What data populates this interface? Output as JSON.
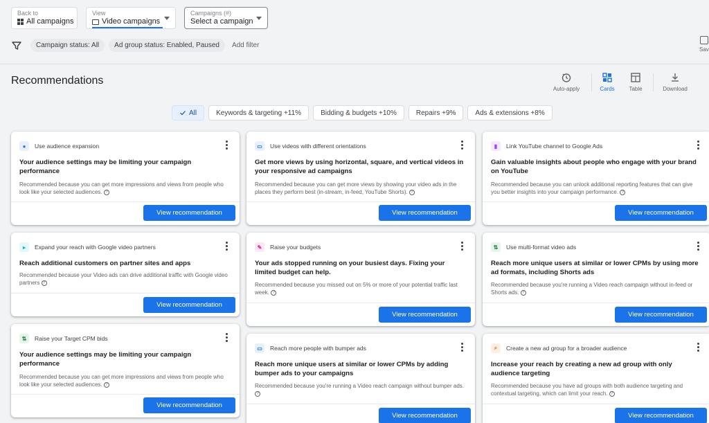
{
  "header": {
    "back": {
      "small": "Back to",
      "label": "All campaigns"
    },
    "view": {
      "small": "View",
      "label": "Video campaigns"
    },
    "campaigns": {
      "small": "Campaigns (#)",
      "label": "Select a campaign"
    }
  },
  "filters": {
    "chips": [
      "Campaign status: All",
      "Ad group status: Enabled, Paused"
    ],
    "add_label": "Add filter",
    "save_label": "Save"
  },
  "page": {
    "title": "Recommendations"
  },
  "tools": {
    "auto_apply": "Auto-apply",
    "cards": "Cards",
    "table": "Table",
    "download": "Download"
  },
  "categories": [
    "All",
    "Keywords & targeting +11%",
    "Bidding & budgets +10%",
    "Repairs +9%",
    "Ads & extensions +8%"
  ],
  "cards": [
    {
      "label": "Use audience expansion",
      "title": "Your audience settings may be limiting your campaign performance",
      "reason": "Recommended because you can get more impressions and views from people who look like your selected audiences.",
      "button": "View recommendation",
      "icon": "audience-icon",
      "icon_color": "#1a73e8",
      "icon_bg": "#e8f0fe"
    },
    {
      "label": "Use videos with different orientations",
      "title": "Get more views by using horizontal, square, and vertical videos in your responsive ad campaigns",
      "reason": "Recommended because you can get more views by showing your video ads in the places they perform best (in-stream, in-feed, YouTube Shorts).",
      "button": "View recommendation",
      "icon": "video-orientation-icon",
      "icon_color": "#1a73e8",
      "icon_bg": "#e8f0fe"
    },
    {
      "label": "Link YouTube channel to Google Ads",
      "title": "Gain valuable insights about people who engage with your brand on YouTube",
      "reason": "Recommended because you can unlock additional reporting features that can give you better insights into your campaign performance.",
      "button": "View recommendation",
      "icon": "insights-icon",
      "icon_color": "#a142f4",
      "icon_bg": "#f3e8fd"
    },
    {
      "label": "Expand your reach with Google video partners",
      "title": "Reach additional customers on partner sites and apps",
      "reason": "Recommended because your Video ads can drive additional traffic with Google video partners",
      "button": "View recommendation",
      "icon": "video-partners-icon",
      "icon_color": "#12b5cb",
      "icon_bg": "#e4f7fb"
    },
    {
      "label": "Raise your budgets",
      "title": "Your ads stopped running on your busiest days. Fixing your limited budget can help.",
      "reason": "Recommended because you missed out on 5% or more of your potential traffic last week.",
      "button": "View recommendation",
      "icon": "wrench-icon",
      "icon_color": "#e52592",
      "icon_bg": "#fde7f3"
    },
    {
      "label": "Use multi-format video ads",
      "title": "Reach more unique users at similar or lower CPMs by using more ad formats, including Shorts ads",
      "reason": "Recommended because you're running a Video reach campaign without in-feed or Shorts ads.",
      "button": "View recommendation",
      "icon": "arrows-icon",
      "icon_color": "#188038",
      "icon_bg": "#e6f4ea"
    },
    {
      "label": "Raise your Target CPM bids",
      "title": "Your audience settings may be limiting your campaign performance",
      "reason": "Recommended because you can get more impressions and views from people who look like your selected audiences.",
      "button": "View recommendation",
      "icon": "arrows-icon",
      "icon_color": "#188038",
      "icon_bg": "#e6f4ea"
    },
    {
      "label": "Reach more people with bumper ads",
      "title": "Reach more unique users at similar or lower CPMs by adding bumper ads to your campaigns",
      "reason": "Recommended because you're running a Video reach campaign without bumper ads.",
      "button": "View recommendation",
      "icon": "bumper-ads-icon",
      "icon_color": "#1a73e8",
      "icon_bg": "#e8f0fe"
    },
    {
      "label": "Create a new ad group for a broader audience",
      "title": "Increase your reach by creating a new ad group with only audience targeting",
      "reason": "Recommended because you have ad groups with both audience targeting and contextual targeting, which can limit your reach.",
      "button": "View recommendation",
      "icon": "search-icon",
      "icon_color": "#e8710a",
      "icon_bg": "#feefe3"
    }
  ]
}
